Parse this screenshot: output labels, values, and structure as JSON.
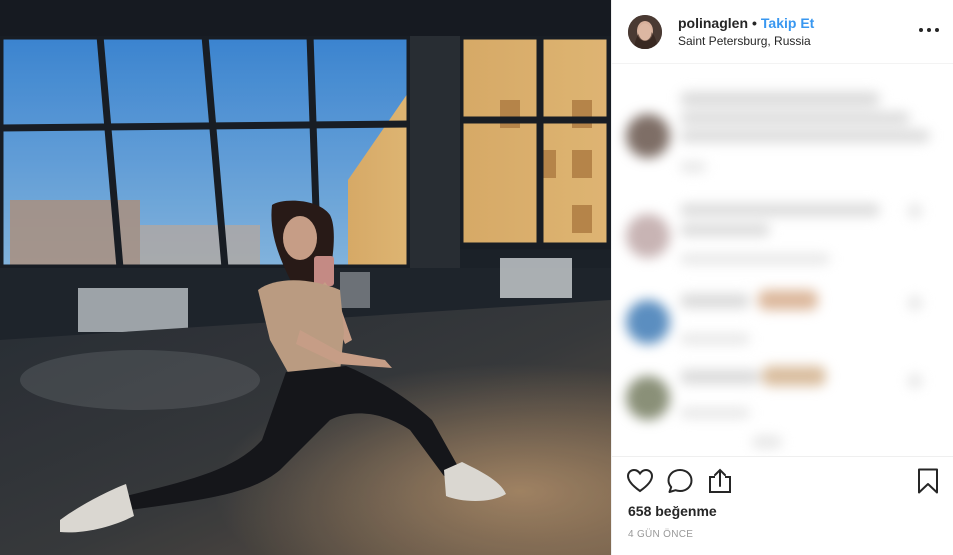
{
  "post": {
    "username": "polinaglen",
    "separator": "•",
    "follow_label": "Takip Et",
    "location": "Saint Petersburg, Russia",
    "likes": "658 beğenme",
    "timestamp": "4 GÜN ÖNCE"
  },
  "icons": {
    "like": "heart-icon",
    "comment": "comment-icon",
    "share": "share-icon",
    "save": "bookmark-icon",
    "more": "more-options-icon"
  }
}
